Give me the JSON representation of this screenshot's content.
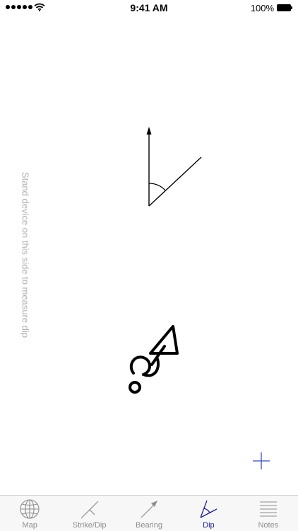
{
  "status_bar": {
    "time": "9:41 AM",
    "battery_percent": "100%",
    "signal_bars": 5
  },
  "main": {
    "side_hint": "Stand device on this side to measure dip",
    "add_icon": "plus-icon"
  },
  "tab_bar": {
    "tabs": [
      {
        "label": "Map",
        "icon": "globe-icon",
        "active": false
      },
      {
        "label": "Strike/Dip",
        "icon": "strike-dip-icon",
        "active": false
      },
      {
        "label": "Bearing",
        "icon": "bearing-arrow-icon",
        "active": false
      },
      {
        "label": "Dip",
        "icon": "dip-angle-icon",
        "active": true
      },
      {
        "label": "Notes",
        "icon": "notes-lines-icon",
        "active": false
      }
    ]
  },
  "colors": {
    "active_tab": "#1d1d8f",
    "inactive_tab": "#8e8e93",
    "accent": "#3a4ab0",
    "hint_text": "#b0b0b0"
  }
}
